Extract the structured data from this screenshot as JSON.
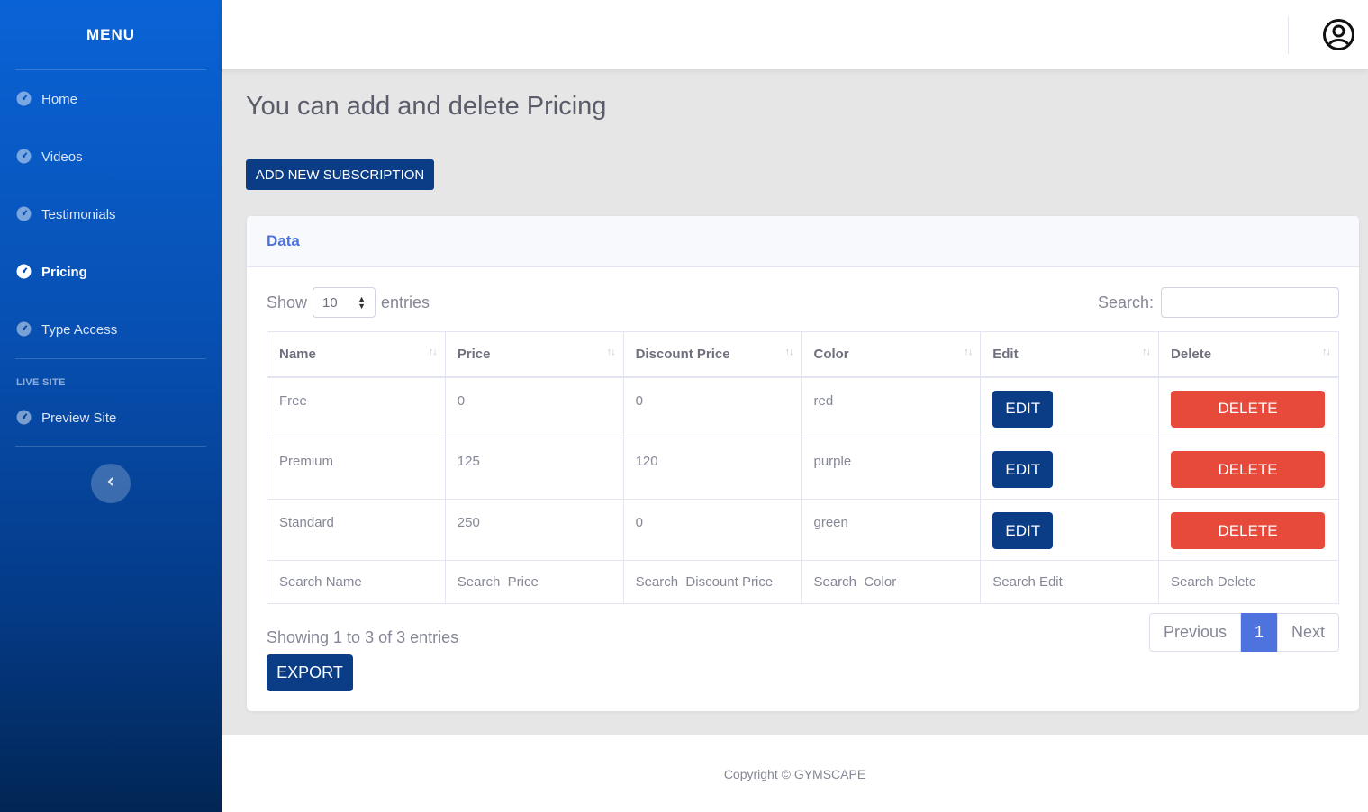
{
  "sidebar": {
    "brand": "MENU",
    "items": [
      {
        "label": "Home",
        "icon": "tachometer-icon"
      },
      {
        "label": "Videos",
        "icon": "tachometer-icon"
      },
      {
        "label": "Testimonials",
        "icon": "tachometer-icon"
      },
      {
        "label": "Pricing",
        "icon": "tachometer-icon",
        "active": true
      },
      {
        "label": "Type Access",
        "icon": "tachometer-icon"
      }
    ],
    "heading": "LIVE SITE",
    "preview": {
      "label": "Preview Site",
      "icon": "tachometer-icon"
    },
    "toggle_icon": "chevron-left-icon"
  },
  "topbar": {
    "user_icon": "user-circle-icon"
  },
  "page": {
    "title": "You can add and delete Pricing",
    "add_button": "ADD NEW SUBSCRIPTION"
  },
  "card": {
    "header": "Data",
    "show_label": "Show",
    "entries_value": "10",
    "entries_label": "entries",
    "search_label": "Search:",
    "search_value": "",
    "columns": [
      "Name",
      "Price",
      "Discount Price",
      "Color",
      "Edit",
      "Delete"
    ],
    "rows": [
      {
        "name": "Free",
        "price": "0",
        "discount": "0",
        "color": "red"
      },
      {
        "name": "Premium",
        "price": "125",
        "discount": "120",
        "color": "purple"
      },
      {
        "name": "Standard",
        "price": "250",
        "discount": "0",
        "color": "green"
      }
    ],
    "edit_label": "EDIT",
    "delete_label": "DELETE",
    "footer_search": [
      "Search Name",
      "Search  Price",
      "Search  Discount Price",
      "Search  Color",
      "Search Edit",
      "Search Delete"
    ],
    "info": "Showing 1 to 3 of 3 entries",
    "export": "EXPORT",
    "pager": {
      "previous": "Previous",
      "current": "1",
      "next": "Next"
    }
  },
  "footer": {
    "copyright": "Copyright © GYMSCAPE"
  },
  "colors": {
    "primary": "#0b3d86",
    "danger": "#e74a3b",
    "accent": "#4e73df",
    "sidebar_top": "#0a63d6",
    "sidebar_bottom": "#022655"
  }
}
